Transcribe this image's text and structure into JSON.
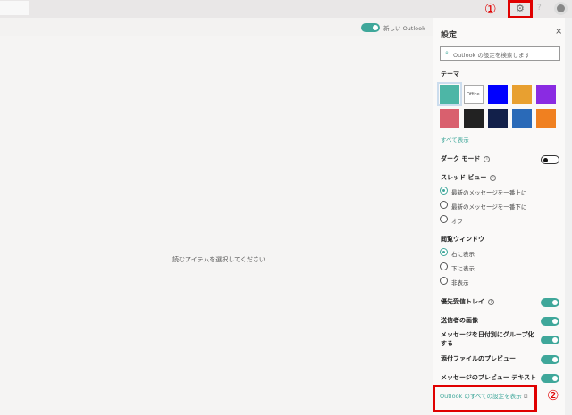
{
  "topbar": {
    "marker1": "①",
    "help": "?"
  },
  "subbar": {
    "new_outlook_label": "新しい Outlook",
    "new_outlook_on": true
  },
  "main": {
    "empty_message": "読むアイテムを選択してください"
  },
  "settings": {
    "title": "設定",
    "search_placeholder": "Outlook の設定を検索します",
    "theme_heading": "テーマ",
    "themes": [
      {
        "name": "teal",
        "color": "#4db6a6"
      },
      {
        "name": "Office",
        "color": "#ffffff",
        "label": "Office"
      },
      {
        "name": "blue",
        "color": "#0000ff"
      },
      {
        "name": "sunset",
        "color": "#e8a030"
      },
      {
        "name": "purple",
        "color": "#8a2be2"
      },
      {
        "name": "palms",
        "color": "#d9606e"
      },
      {
        "name": "black",
        "color": "#222222"
      },
      {
        "name": "navy",
        "color": "#12204a"
      },
      {
        "name": "circuit",
        "color": "#2a6ab8"
      },
      {
        "name": "lego",
        "color": "#f08020"
      }
    ],
    "show_all": "すべて表示",
    "dark_mode": {
      "label": "ダーク モード",
      "on": false
    },
    "thread_view": {
      "heading": "スレッド ビュー",
      "options": [
        "最新のメッセージを一番上に",
        "最新のメッセージを一番下に",
        "オフ"
      ],
      "selected": 0
    },
    "reading_pane": {
      "heading": "閲覧ウィンドウ",
      "options": [
        "右に表示",
        "下に表示",
        "非表示"
      ],
      "selected": 0
    },
    "toggles": [
      {
        "label": "優先受信トレイ",
        "on": true,
        "info": true
      },
      {
        "label": "送信者の画像",
        "on": true
      },
      {
        "label": "メッセージを日付別にグループ化する",
        "on": true
      },
      {
        "label": "添付ファイルのプレビュー",
        "on": true
      },
      {
        "label": "メッセージのプレビュー テキスト",
        "on": true
      }
    ],
    "all_settings_link": "Outlook のすべての設定を表示",
    "marker2": "②"
  },
  "colors": {
    "accent": "#3fa79a",
    "annotation": "#e00000"
  }
}
